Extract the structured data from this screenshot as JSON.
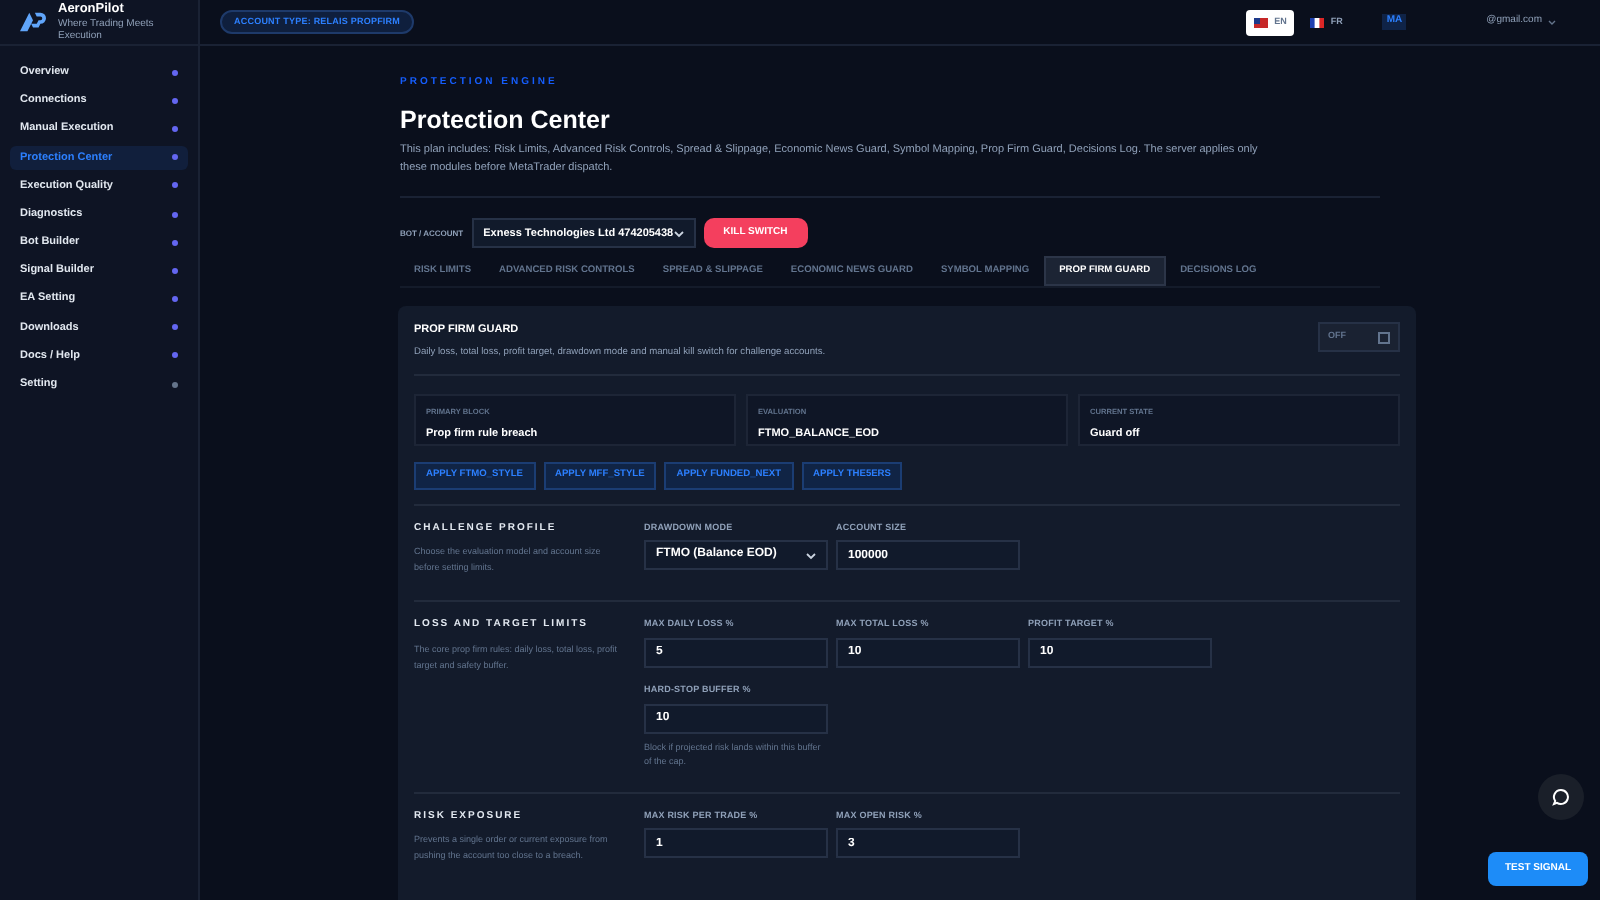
{
  "brand": {
    "name": "AeronPilot",
    "tagline": "Where Trading Meets Execution"
  },
  "account_badge": "ACCOUNT TYPE: RELAIS PROPFIRM",
  "languages": [
    {
      "code": "EN",
      "selected": true
    },
    {
      "code": "FR",
      "selected": false
    }
  ],
  "user": {
    "initials": "MA",
    "email": "@gmail.com"
  },
  "sidebar": {
    "items": [
      {
        "label": "Overview",
        "selected": false,
        "color": "#6366f1"
      },
      {
        "label": "Connections",
        "selected": false,
        "color": "#6366f1"
      },
      {
        "label": "Manual Execution",
        "selected": false,
        "color": "#6366f1"
      },
      {
        "label": "Protection Center",
        "selected": true,
        "color": "#6366f1"
      },
      {
        "label": "Execution Quality",
        "selected": false,
        "color": "#6366f1"
      },
      {
        "label": "Diagnostics",
        "selected": false,
        "color": "#6366f1"
      },
      {
        "label": "Bot Builder",
        "selected": false,
        "color": "#6366f1"
      },
      {
        "label": "Signal Builder",
        "selected": false,
        "color": "#6366f1"
      },
      {
        "label": "EA Setting",
        "selected": false,
        "color": "#6366f1"
      },
      {
        "label": "Downloads",
        "selected": false,
        "color": "#6366f1"
      },
      {
        "label": "Docs / Help",
        "selected": false,
        "color": "#6366f1"
      },
      {
        "label": "Setting",
        "selected": false,
        "color": "#64748b"
      }
    ]
  },
  "page": {
    "eyebrow": "PROTECTION ENGINE",
    "title": "Protection Center",
    "description": "This plan includes: Risk Limits, Advanced Risk Controls, Spread & Slippage, Economic News Guard, Symbol Mapping, Prop Firm Guard, Decisions Log. The server applies only these modules before MetaTrader dispatch."
  },
  "account_select": {
    "label": "BOT / ACCOUNT",
    "value": "Exness Technologies Ltd 474205438"
  },
  "kill_switch": "KILL SWITCH",
  "tabs": [
    {
      "label": "RISK LIMITS",
      "selected": false
    },
    {
      "label": "ADVANCED RISK CONTROLS",
      "selected": false
    },
    {
      "label": "SPREAD & SLIPPAGE",
      "selected": false
    },
    {
      "label": "ECONOMIC NEWS GUARD",
      "selected": false
    },
    {
      "label": "SYMBOL MAPPING",
      "selected": false
    },
    {
      "label": "PROP FIRM GUARD",
      "selected": true
    },
    {
      "label": "DECISIONS LOG",
      "selected": false
    }
  ],
  "guard": {
    "title": "PROP FIRM GUARD",
    "description": "Daily loss, total loss, profit target, drawdown mode and manual kill switch for challenge accounts.",
    "toggle": {
      "label": "OFF",
      "on": false
    },
    "stats": [
      {
        "label": "PRIMARY BLOCK",
        "value": "Prop firm rule breach"
      },
      {
        "label": "EVALUATION",
        "value": "FTMO_BALANCE_EOD"
      },
      {
        "label": "CURRENT STATE",
        "value": "Guard off"
      }
    ],
    "presets": [
      "APPLY FTMO_STYLE",
      "APPLY MFF_STYLE",
      "APPLY FUNDED_NEXT",
      "APPLY THE5ERS"
    ],
    "sections": [
      {
        "title": "CHALLENGE PROFILE",
        "description": "Choose the evaluation model and account size before setting limits.",
        "fields": [
          {
            "kind": "select",
            "label": "DRAWDOWN MODE",
            "value": "FTMO (Balance EOD)"
          },
          {
            "kind": "input",
            "label": "ACCOUNT SIZE",
            "value": "100000"
          }
        ]
      },
      {
        "title": "LOSS AND TARGET LIMITS",
        "description": "The core prop firm rules: daily loss, total loss, profit target and safety buffer.",
        "fields": [
          {
            "kind": "input",
            "label": "MAX DAILY LOSS %",
            "value": "5"
          },
          {
            "kind": "input",
            "label": "MAX TOTAL LOSS %",
            "value": "10"
          },
          {
            "kind": "input",
            "label": "PROFIT TARGET %",
            "value": "10"
          },
          {
            "kind": "input",
            "label": "HARD-STOP BUFFER %",
            "value": "10",
            "hint": "Block if projected risk lands within this buffer of the cap."
          }
        ]
      },
      {
        "title": "RISK EXPOSURE",
        "description": "Prevents a single order or current exposure from pushing the account too close to a breach.",
        "fields": [
          {
            "kind": "input",
            "label": "MAX RISK PER TRADE %",
            "value": "1"
          },
          {
            "kind": "input",
            "label": "MAX OPEN RISK %",
            "value": "3"
          }
        ]
      }
    ]
  },
  "test_signal": "TEST SIGNAL"
}
